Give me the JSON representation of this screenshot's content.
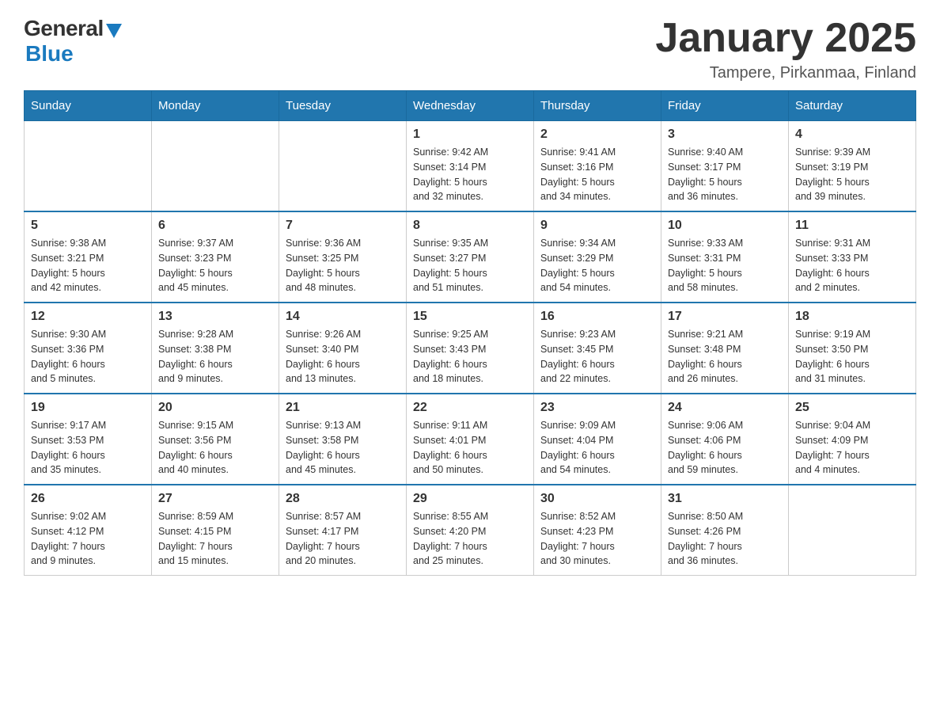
{
  "header": {
    "logo_general": "General",
    "logo_blue": "Blue",
    "month_title": "January 2025",
    "location": "Tampere, Pirkanmaa, Finland"
  },
  "weekdays": [
    "Sunday",
    "Monday",
    "Tuesday",
    "Wednesday",
    "Thursday",
    "Friday",
    "Saturday"
  ],
  "weeks": [
    [
      {
        "day": "",
        "info": ""
      },
      {
        "day": "",
        "info": ""
      },
      {
        "day": "",
        "info": ""
      },
      {
        "day": "1",
        "info": "Sunrise: 9:42 AM\nSunset: 3:14 PM\nDaylight: 5 hours\nand 32 minutes."
      },
      {
        "day": "2",
        "info": "Sunrise: 9:41 AM\nSunset: 3:16 PM\nDaylight: 5 hours\nand 34 minutes."
      },
      {
        "day": "3",
        "info": "Sunrise: 9:40 AM\nSunset: 3:17 PM\nDaylight: 5 hours\nand 36 minutes."
      },
      {
        "day": "4",
        "info": "Sunrise: 9:39 AM\nSunset: 3:19 PM\nDaylight: 5 hours\nand 39 minutes."
      }
    ],
    [
      {
        "day": "5",
        "info": "Sunrise: 9:38 AM\nSunset: 3:21 PM\nDaylight: 5 hours\nand 42 minutes."
      },
      {
        "day": "6",
        "info": "Sunrise: 9:37 AM\nSunset: 3:23 PM\nDaylight: 5 hours\nand 45 minutes."
      },
      {
        "day": "7",
        "info": "Sunrise: 9:36 AM\nSunset: 3:25 PM\nDaylight: 5 hours\nand 48 minutes."
      },
      {
        "day": "8",
        "info": "Sunrise: 9:35 AM\nSunset: 3:27 PM\nDaylight: 5 hours\nand 51 minutes."
      },
      {
        "day": "9",
        "info": "Sunrise: 9:34 AM\nSunset: 3:29 PM\nDaylight: 5 hours\nand 54 minutes."
      },
      {
        "day": "10",
        "info": "Sunrise: 9:33 AM\nSunset: 3:31 PM\nDaylight: 5 hours\nand 58 minutes."
      },
      {
        "day": "11",
        "info": "Sunrise: 9:31 AM\nSunset: 3:33 PM\nDaylight: 6 hours\nand 2 minutes."
      }
    ],
    [
      {
        "day": "12",
        "info": "Sunrise: 9:30 AM\nSunset: 3:36 PM\nDaylight: 6 hours\nand 5 minutes."
      },
      {
        "day": "13",
        "info": "Sunrise: 9:28 AM\nSunset: 3:38 PM\nDaylight: 6 hours\nand 9 minutes."
      },
      {
        "day": "14",
        "info": "Sunrise: 9:26 AM\nSunset: 3:40 PM\nDaylight: 6 hours\nand 13 minutes."
      },
      {
        "day": "15",
        "info": "Sunrise: 9:25 AM\nSunset: 3:43 PM\nDaylight: 6 hours\nand 18 minutes."
      },
      {
        "day": "16",
        "info": "Sunrise: 9:23 AM\nSunset: 3:45 PM\nDaylight: 6 hours\nand 22 minutes."
      },
      {
        "day": "17",
        "info": "Sunrise: 9:21 AM\nSunset: 3:48 PM\nDaylight: 6 hours\nand 26 minutes."
      },
      {
        "day": "18",
        "info": "Sunrise: 9:19 AM\nSunset: 3:50 PM\nDaylight: 6 hours\nand 31 minutes."
      }
    ],
    [
      {
        "day": "19",
        "info": "Sunrise: 9:17 AM\nSunset: 3:53 PM\nDaylight: 6 hours\nand 35 minutes."
      },
      {
        "day": "20",
        "info": "Sunrise: 9:15 AM\nSunset: 3:56 PM\nDaylight: 6 hours\nand 40 minutes."
      },
      {
        "day": "21",
        "info": "Sunrise: 9:13 AM\nSunset: 3:58 PM\nDaylight: 6 hours\nand 45 minutes."
      },
      {
        "day": "22",
        "info": "Sunrise: 9:11 AM\nSunset: 4:01 PM\nDaylight: 6 hours\nand 50 minutes."
      },
      {
        "day": "23",
        "info": "Sunrise: 9:09 AM\nSunset: 4:04 PM\nDaylight: 6 hours\nand 54 minutes."
      },
      {
        "day": "24",
        "info": "Sunrise: 9:06 AM\nSunset: 4:06 PM\nDaylight: 6 hours\nand 59 minutes."
      },
      {
        "day": "25",
        "info": "Sunrise: 9:04 AM\nSunset: 4:09 PM\nDaylight: 7 hours\nand 4 minutes."
      }
    ],
    [
      {
        "day": "26",
        "info": "Sunrise: 9:02 AM\nSunset: 4:12 PM\nDaylight: 7 hours\nand 9 minutes."
      },
      {
        "day": "27",
        "info": "Sunrise: 8:59 AM\nSunset: 4:15 PM\nDaylight: 7 hours\nand 15 minutes."
      },
      {
        "day": "28",
        "info": "Sunrise: 8:57 AM\nSunset: 4:17 PM\nDaylight: 7 hours\nand 20 minutes."
      },
      {
        "day": "29",
        "info": "Sunrise: 8:55 AM\nSunset: 4:20 PM\nDaylight: 7 hours\nand 25 minutes."
      },
      {
        "day": "30",
        "info": "Sunrise: 8:52 AM\nSunset: 4:23 PM\nDaylight: 7 hours\nand 30 minutes."
      },
      {
        "day": "31",
        "info": "Sunrise: 8:50 AM\nSunset: 4:26 PM\nDaylight: 7 hours\nand 36 minutes."
      },
      {
        "day": "",
        "info": ""
      }
    ]
  ]
}
